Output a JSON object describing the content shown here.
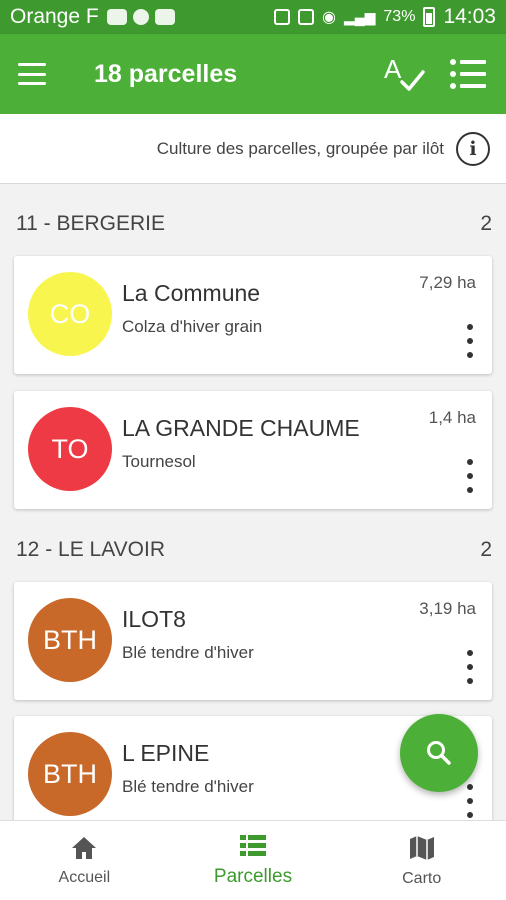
{
  "status_bar": {
    "carrier": "Orange F",
    "battery": "73%",
    "time": "14:03"
  },
  "app_bar": {
    "title": "18 parcelles",
    "icons": [
      "menu-icon",
      "spellcheck-icon",
      "list-icon"
    ]
  },
  "subheader": {
    "text": "Culture des parcelles, groupée par ilôt",
    "icon": "info-icon"
  },
  "groups": [
    {
      "name": "11 - BERGERIE",
      "count": "2",
      "parcels": [
        {
          "abbr": "CO",
          "name": "La Commune",
          "crop": "Colza d'hiver grain",
          "area": "7,29 ha",
          "color": "#f9f54f"
        },
        {
          "abbr": "TO",
          "name": "LA GRANDE CHAUME",
          "crop": "Tournesol",
          "area": "1,4 ha",
          "color": "#ee3a44"
        }
      ]
    },
    {
      "name": "12 - LE LAVOIR",
      "count": "2",
      "parcels": [
        {
          "abbr": "BTH",
          "name": "ILOT8",
          "crop": "Blé tendre d'hiver",
          "area": "3,19 ha",
          "color": "#c8692a"
        },
        {
          "abbr": "BTH",
          "name": "L EPINE",
          "crop": "Blé tendre d'hiver",
          "area": "",
          "color": "#c8692a"
        }
      ]
    }
  ],
  "fab": {
    "icon": "search-icon"
  },
  "bottom_nav": [
    {
      "label": "Accueil",
      "icon": "home-icon"
    },
    {
      "label": "Parcelles",
      "icon": "list-icon",
      "active": true
    },
    {
      "label": "Carto",
      "icon": "map-icon"
    }
  ],
  "colors": {
    "primary": "#4caf37",
    "status_bar": "#3e9a2e"
  }
}
